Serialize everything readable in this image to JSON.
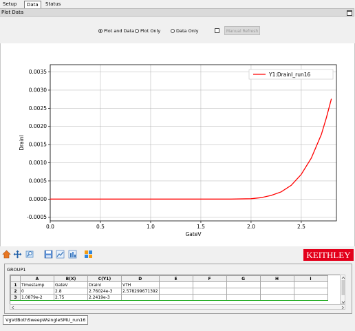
{
  "tabs": [
    "Setup",
    "Data",
    "Status"
  ],
  "panel_title": "Plot Data",
  "options": {
    "plot_and_data": "Plot and Data",
    "plot_only": "Plot Only",
    "data_only": "Data Only",
    "selected": "Plot and Data",
    "manual_refresh": "Manual Refresh",
    "manual_refresh_checked": false
  },
  "brand": "KEITHLEY",
  "brand_color": "#e3001b",
  "toolbar_icons": [
    "home-icon",
    "move-icon",
    "zoom-icon",
    "save-icon",
    "chart-icon",
    "grid-icon",
    "export-icon"
  ],
  "group_tab": "GROUP1",
  "sheet": {
    "columns": [
      "",
      "A",
      "B(X)",
      "C(Y1)",
      "D",
      "E",
      "F",
      "G",
      "H",
      "I"
    ],
    "rows": [
      [
        "1",
        "Timestamp",
        "GateV",
        "DrainI",
        "VTH",
        "",
        "",
        "",
        "",
        ""
      ],
      [
        "2",
        "0",
        "2.8",
        "2.76024e-3",
        "2.578299671392",
        "",
        "",
        "",
        "",
        ""
      ],
      [
        "3",
        "1.0879e-2",
        "2.75",
        "2.2419e-3",
        "",
        "",
        "",
        "",
        "",
        ""
      ]
    ]
  },
  "sheet_tab": "VgVdBothSweepWsingleSMU_run16",
  "chart_data": {
    "type": "line",
    "xlabel": "GateV",
    "ylabel": "DrainI",
    "xlim": [
      0.0,
      2.85
    ],
    "ylim": [
      -0.0006,
      0.0037
    ],
    "xticks": [
      "0.0",
      "0.5",
      "1.0",
      "1.5",
      "2.0",
      "2.5"
    ],
    "yticks": [
      "-0.0005",
      "0.0000",
      "0.0005",
      "0.0010",
      "0.0015",
      "0.0020",
      "0.0025",
      "0.0030",
      "0.0035"
    ],
    "grid": true,
    "legend_position": "top-right",
    "series": [
      {
        "name": "Y1:DrainI_run16",
        "color": "#ff0000",
        "x": [
          0.0,
          0.5,
          1.0,
          1.5,
          1.8,
          2.0,
          2.1,
          2.2,
          2.3,
          2.4,
          2.5,
          2.6,
          2.7,
          2.75,
          2.8
        ],
        "y": [
          0.0,
          0.0,
          0.0,
          0.0,
          0.0,
          1e-05,
          4e-05,
          0.0001,
          0.0002,
          0.00038,
          0.00068,
          0.00113,
          0.00178,
          0.00224,
          0.00276
        ]
      }
    ]
  }
}
